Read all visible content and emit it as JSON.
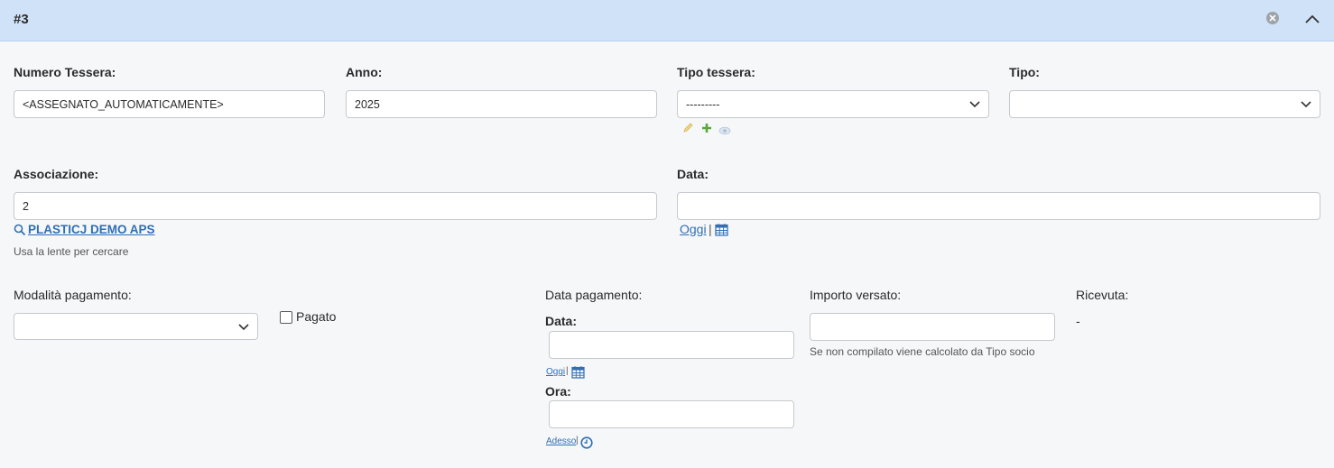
{
  "header": {
    "title": "#3"
  },
  "fields": {
    "numero_tessera": {
      "label": "Numero Tessera:",
      "value": "<ASSEGNATO_AUTOMATICAMENTE>"
    },
    "anno": {
      "label": "Anno:",
      "value": "2025"
    },
    "tipo_tessera": {
      "label": "Tipo tessera:",
      "value": "---------"
    },
    "tipo": {
      "label": "Tipo:",
      "value": ""
    },
    "associazione": {
      "label": "Associazione:",
      "value": "2",
      "link": "PLASTICJ DEMO APS",
      "help": "Usa la lente per cercare"
    },
    "data": {
      "label": "Data:",
      "value": "",
      "today_link": "Oggi",
      "sep": "|"
    },
    "modalita_pagamento": {
      "label": "Modalità pagamento:",
      "value": ""
    },
    "pagato": {
      "label": "Pagato",
      "checked": false
    },
    "data_pagamento": {
      "label": "Data pagamento:",
      "data_label": "Data:",
      "data_value": "",
      "today_link": "Oggi",
      "ora_label": "Ora:",
      "ora_value": "",
      "now_link": "Adesso",
      "sep": "|"
    },
    "importo_versato": {
      "label": "Importo versato:",
      "value": "",
      "help": "Se non compilato viene calcolato da Tipo socio"
    },
    "ricevuta": {
      "label": "Ricevuta:",
      "value": "-"
    }
  },
  "icons": {
    "edit": "pencil-icon",
    "add": "plus-icon",
    "view": "eye-icon",
    "search": "search-icon",
    "calendar": "calendar-icon",
    "clock": "clock-icon"
  },
  "colors": {
    "header_bg": "#cfe2f7",
    "link": "#2f6fb5",
    "add_green": "#5aa83a",
    "edit_yellow": "#e8c86a"
  }
}
